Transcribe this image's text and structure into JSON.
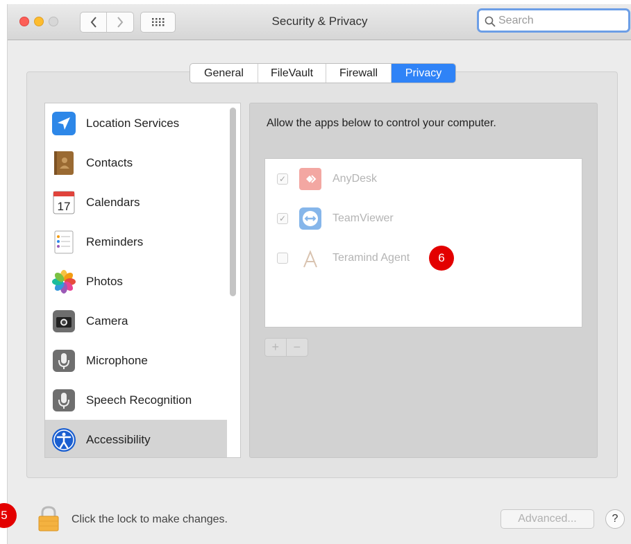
{
  "window": {
    "title": "Security & Privacy"
  },
  "search": {
    "placeholder": "Search"
  },
  "tabs": [
    "General",
    "FileVault",
    "Firewall",
    "Privacy"
  ],
  "active_tab": "Privacy",
  "sidebar": {
    "items": [
      {
        "label": "Location Services",
        "icon": "location-arrow-icon"
      },
      {
        "label": "Contacts",
        "icon": "contacts-book-icon"
      },
      {
        "label": "Calendars",
        "icon": "calendar-icon",
        "icon_text": "17"
      },
      {
        "label": "Reminders",
        "icon": "reminders-list-icon"
      },
      {
        "label": "Photos",
        "icon": "photos-pinwheel-icon"
      },
      {
        "label": "Camera",
        "icon": "camera-icon"
      },
      {
        "label": "Microphone",
        "icon": "microphone-icon"
      },
      {
        "label": "Speech Recognition",
        "icon": "speech-microphone-icon"
      },
      {
        "label": "Accessibility",
        "icon": "accessibility-icon",
        "selected": true
      }
    ]
  },
  "main": {
    "heading": "Allow the apps below to control your computer.",
    "apps": [
      {
        "name": "AnyDesk",
        "checked": true,
        "icon": "anydesk-icon"
      },
      {
        "name": "TeamViewer",
        "checked": true,
        "icon": "teamviewer-icon"
      },
      {
        "name": "Teramind Agent",
        "checked": false,
        "icon": "teramind-icon"
      }
    ],
    "add_label": "+",
    "remove_label": "−"
  },
  "footer": {
    "lock_text": "Click the lock to make changes.",
    "advanced_label": "Advanced...",
    "help_label": "?"
  },
  "annotations": {
    "badge_lock": "5",
    "badge_app": "6"
  },
  "colors": {
    "accent": "#2f83f7",
    "badge": "#e30000"
  }
}
